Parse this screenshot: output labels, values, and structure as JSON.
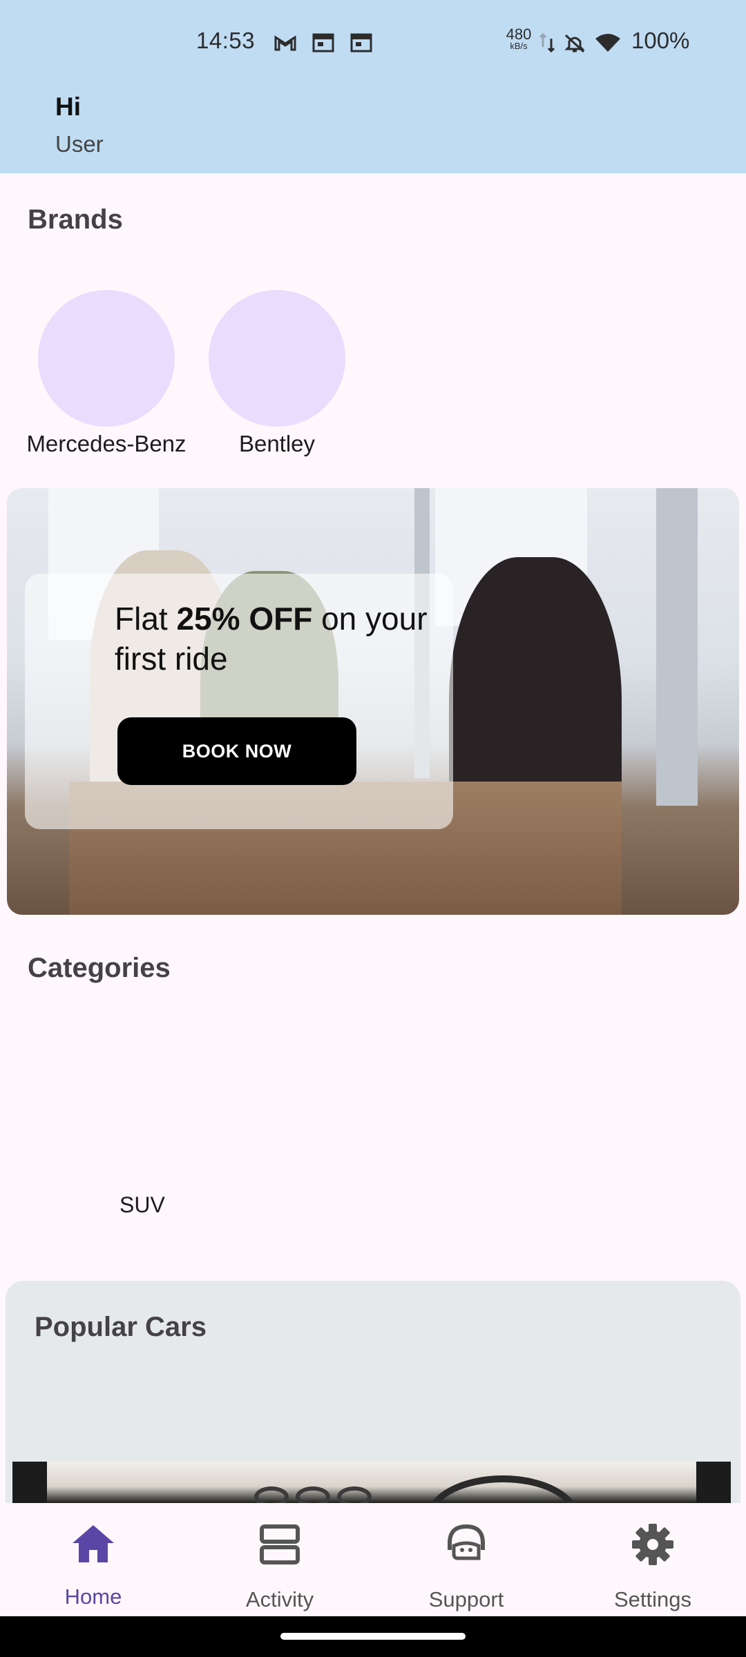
{
  "status_bar": {
    "time": "14:53",
    "net_speed": "480",
    "net_unit": "kB/s",
    "battery": "100%",
    "icons": [
      "gmail-icon",
      "calendar-icon",
      "calendar-icon",
      "data-arrows-icon",
      "bell-off-icon",
      "wifi-icon"
    ]
  },
  "header": {
    "greeting": "Hi",
    "subtitle": "User"
  },
  "brands": {
    "title": "Brands",
    "items": [
      {
        "label": "Mercedes-Benz"
      },
      {
        "label": "Bentley"
      }
    ]
  },
  "banner": {
    "text_prefix": "Flat ",
    "text_bold": "25% OFF",
    "text_suffix": " on your first ride",
    "button_label": "BOOK NOW"
  },
  "categories": {
    "title": "Categories",
    "items": [
      {
        "label": "SUV"
      }
    ]
  },
  "popular": {
    "title": "Popular Cars"
  },
  "bottom_nav": {
    "items": [
      {
        "label": "Home",
        "icon": "home-icon",
        "active": true
      },
      {
        "label": "Activity",
        "icon": "activity-icon",
        "active": false
      },
      {
        "label": "Support",
        "icon": "support-icon",
        "active": false
      },
      {
        "label": "Settings",
        "icon": "settings-icon",
        "active": false
      }
    ]
  },
  "colors": {
    "header_bg": "#C0DCF3",
    "accent": "#5A46A5",
    "brand_circle": "#E8DDFD",
    "page_bg": "#FEF7FC"
  }
}
